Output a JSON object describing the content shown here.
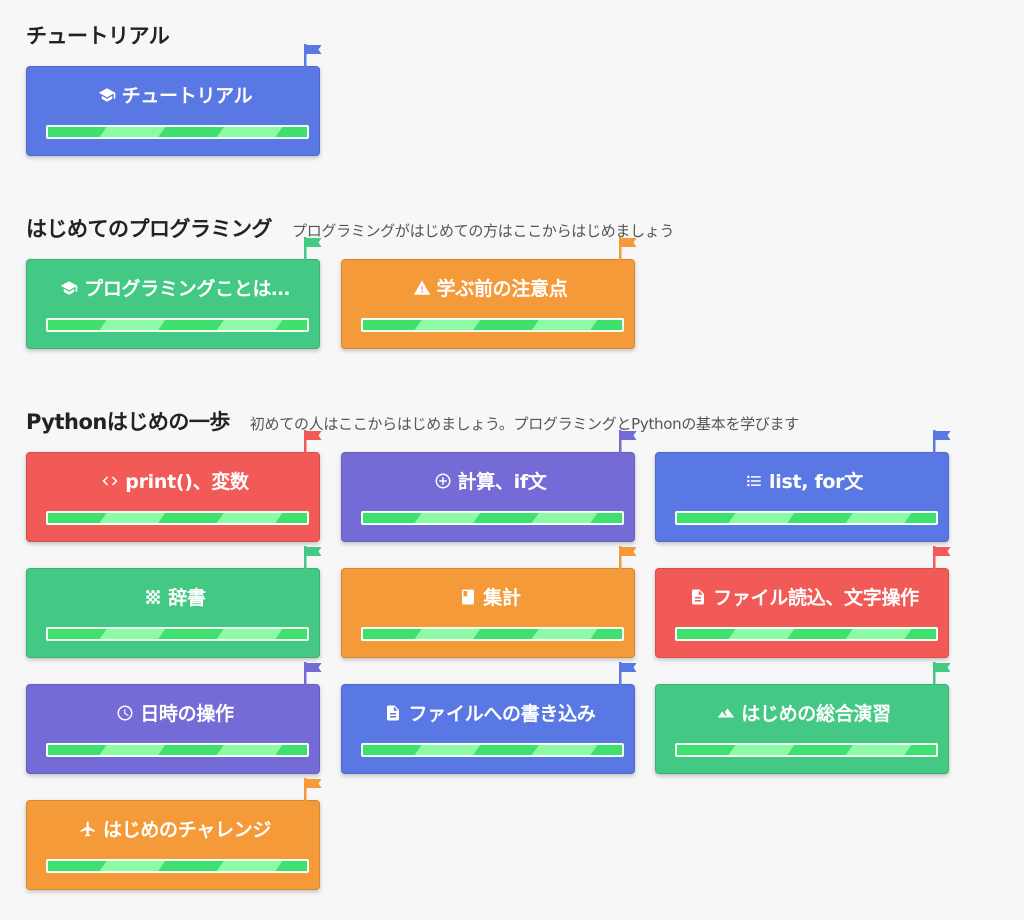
{
  "colors": {
    "blue": "#5a78e4",
    "green": "#44c985",
    "orange": "#f49a38",
    "red": "#f25a58",
    "purple": "#746bd6",
    "progress_dark": "#3fe06d",
    "progress_light": "#8dfba5"
  },
  "sections": [
    {
      "title": "チュートリアル",
      "description": "",
      "cards": [
        {
          "label": "チュートリアル",
          "icon": "graduation-cap-icon",
          "color": "blue"
        }
      ]
    },
    {
      "title": "はじめてのプログラミング",
      "description": "プログラミングがはじめての方はここからはじめましょう",
      "cards": [
        {
          "label": "プログラミングことは…",
          "icon": "graduation-cap-icon",
          "color": "green"
        },
        {
          "label": "学ぶ前の注意点",
          "icon": "warning-icon",
          "color": "orange"
        }
      ]
    },
    {
      "title": "Pythonはじめの一歩",
      "description": "初めての人はここからはじめましょう。プログラミングとPythonの基本を学びます",
      "cards": [
        {
          "label": "print()、変数",
          "icon": "code-icon",
          "color": "red"
        },
        {
          "label": "計算、if文",
          "icon": "plus-circle-icon",
          "color": "purple"
        },
        {
          "label": "list, for文",
          "icon": "list-icon",
          "color": "blue"
        },
        {
          "label": "辞書",
          "icon": "dictionary-icon",
          "color": "green"
        },
        {
          "label": "集計",
          "icon": "book-icon",
          "color": "orange"
        },
        {
          "label": "ファイル読込、文字操作",
          "icon": "file-icon",
          "color": "red"
        },
        {
          "label": "日時の操作",
          "icon": "clock-icon",
          "color": "purple"
        },
        {
          "label": "ファイルへの書き込み",
          "icon": "file-icon",
          "color": "blue"
        },
        {
          "label": "はじめの総合演習",
          "icon": "mountain-icon",
          "color": "green"
        },
        {
          "label": "はじめのチャレンジ",
          "icon": "plane-icon",
          "color": "orange"
        }
      ]
    }
  ]
}
